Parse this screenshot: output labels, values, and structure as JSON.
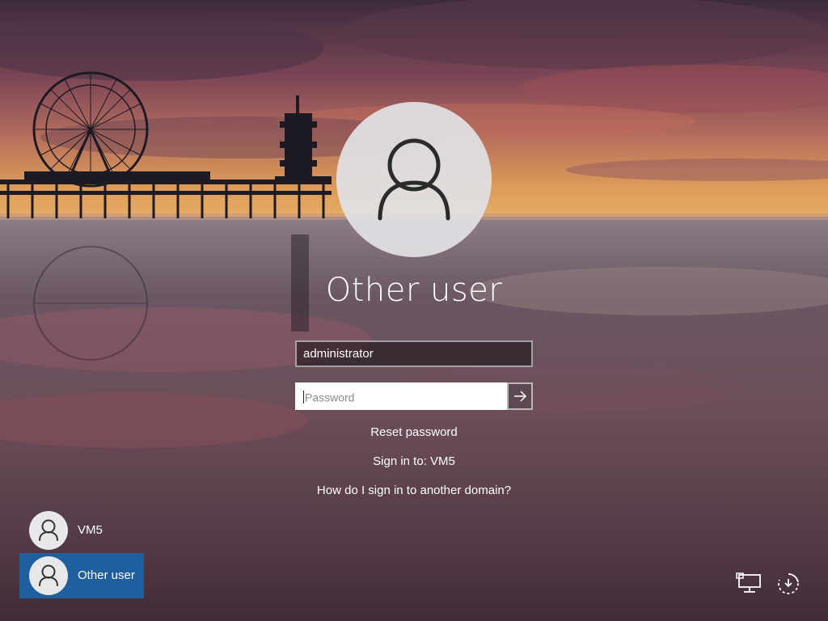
{
  "login": {
    "display_name": "Other user",
    "username_value": "administrator",
    "password_placeholder": "Password",
    "submit_icon": "arrow-right-icon"
  },
  "links": {
    "reset_password": "Reset password",
    "sign_in_to": "Sign in to: VM5",
    "other_domain": "How do I sign in to another domain?"
  },
  "user_list": [
    {
      "label": "VM5",
      "selected": false
    },
    {
      "label": "Other user",
      "selected": true
    }
  ],
  "corner_icons": {
    "network": "network-icon",
    "accessibility": "ease-of-access-icon",
    "power": "power-icon"
  },
  "colors": {
    "selected_tile": "#1f5f9e",
    "avatar_circle": "#e1e1e4",
    "text": "#ffffff"
  }
}
